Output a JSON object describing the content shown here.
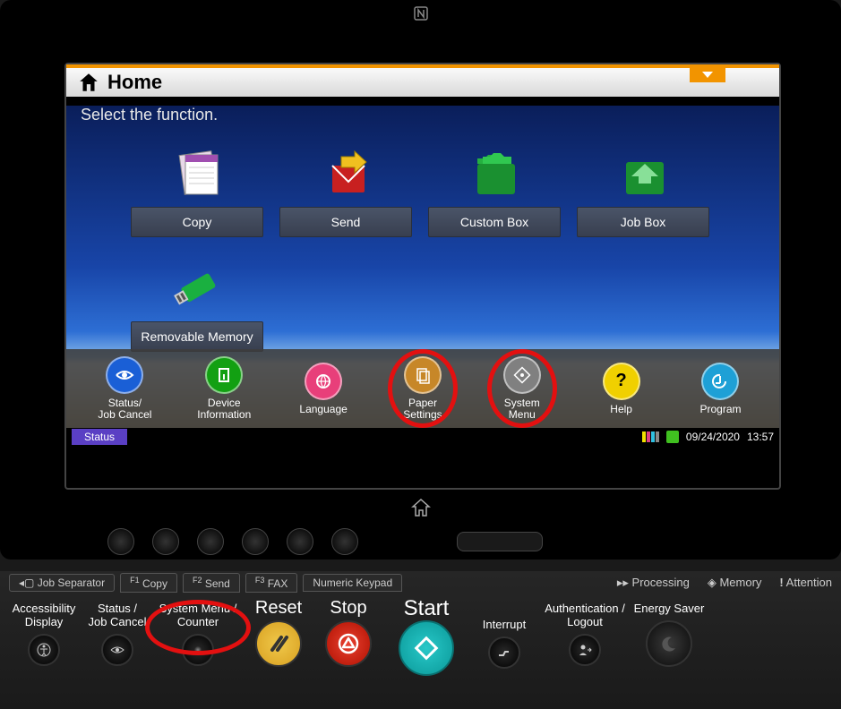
{
  "header": {
    "title": "Home"
  },
  "instruction": "Select the function.",
  "functions": {
    "copy": "Copy",
    "send": "Send",
    "custom_box": "Custom Box",
    "job_box": "Job Box",
    "removable_memory": "Removable Memory"
  },
  "shortcuts": {
    "status": {
      "line1": "Status/",
      "line2": "Job Cancel",
      "color": "#1a5fd6"
    },
    "device": {
      "line1": "Device",
      "line2": "Information",
      "color": "#12a012"
    },
    "language": {
      "line1": "Language",
      "line2": "",
      "color": "#e83f7a"
    },
    "paper": {
      "line1": "Paper",
      "line2": "Settings",
      "color": "#c78728"
    },
    "system": {
      "line1": "System",
      "line2": "Menu",
      "color": "#808080"
    },
    "help": {
      "line1": "Help",
      "line2": "",
      "color": "#f0d000",
      "text": "?"
    },
    "program": {
      "line1": "Program",
      "line2": "",
      "color": "#1ea0d6"
    }
  },
  "status_bar": {
    "label": "Status",
    "date": "09/24/2020",
    "time": "13:57"
  },
  "fn_row": {
    "job_separator": "Job Separator",
    "f1": "Copy",
    "f1p": "F1",
    "f2": "Send",
    "f2p": "F2",
    "f3": "FAX",
    "f3p": "F3",
    "numeric": "Numeric Keypad",
    "processing": "Processing",
    "memory": "Memory",
    "attention": "Attention"
  },
  "hw": {
    "accessibility": {
      "label": "Accessibility Display"
    },
    "status": {
      "line1": "Status /",
      "line2": "Job Cancel"
    },
    "system_menu": {
      "line1": "System Menu /",
      "line2": "Counter"
    },
    "reset": "Reset",
    "stop": "Stop",
    "start": "Start",
    "interrupt": "Interrupt",
    "auth": {
      "line1": "Authentication /",
      "line2": "Logout"
    },
    "energy": "Energy Saver"
  }
}
